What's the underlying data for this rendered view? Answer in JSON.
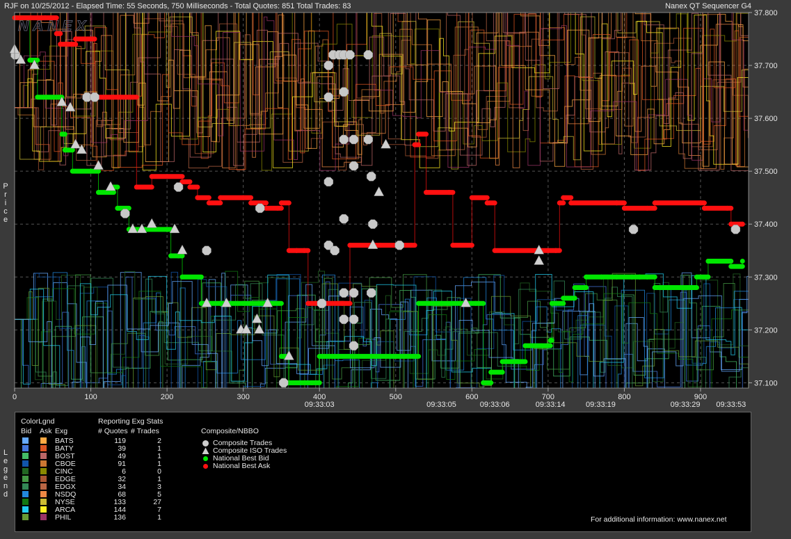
{
  "header": {
    "left": "RJF on 10/25/2012  -  Elapsed Time: 55 Seconds, 750 Milliseconds  -  Total Quotes: 851  Total Trades: 83",
    "right": "Nanex QT Sequencer G4",
    "watermark": "NANEX"
  },
  "side_labels": {
    "price": [
      "P",
      "r",
      "i",
      "c",
      "e"
    ],
    "legend": [
      "L",
      "e",
      "g",
      "e",
      "n",
      "d"
    ]
  },
  "chart_data": {
    "type": "line",
    "ylim": [
      37.09,
      37.8
    ],
    "xlim": [
      0,
      963
    ],
    "y_ticks": [
      "37.100",
      "37.200",
      "37.300",
      "37.400",
      "37.500",
      "37.600",
      "37.700",
      "37.800"
    ],
    "x_ticks": [
      "0",
      "100",
      "200",
      "300",
      "400",
      "500",
      "600",
      "700",
      "800",
      "900"
    ],
    "time_ticks": [
      {
        "x": 400,
        "label": "09:33:03"
      },
      {
        "x": 560,
        "label": "09:33:05"
      },
      {
        "x": 630,
        "label": "09:33:06"
      },
      {
        "x": 703,
        "label": "09:33:14"
      },
      {
        "x": 769,
        "label": "09:33:19"
      },
      {
        "x": 880,
        "label": "09:33:29"
      },
      {
        "x": 940,
        "label": "09:33:53"
      }
    ],
    "series": [
      {
        "name": "National Best Bid",
        "color": "#00e600",
        "points": [
          [
            0,
            37.79
          ],
          [
            20,
            37.71
          ],
          [
            30,
            37.64
          ],
          [
            60,
            37.64
          ],
          [
            62,
            37.57
          ],
          [
            66,
            37.54
          ],
          [
            76,
            37.5
          ],
          [
            100,
            37.5
          ],
          [
            110,
            37.46
          ],
          [
            130,
            37.47
          ],
          [
            135,
            37.43
          ],
          [
            150,
            37.39
          ],
          [
            200,
            37.39
          ],
          [
            205,
            37.34
          ],
          [
            215,
            37.34
          ],
          [
            220,
            37.3
          ],
          [
            245,
            37.25
          ],
          [
            255,
            37.25
          ],
          [
            270,
            37.25
          ],
          [
            300,
            37.25
          ],
          [
            320,
            37.25
          ],
          [
            350,
            37.15
          ],
          [
            360,
            37.1
          ],
          [
            390,
            37.1
          ],
          [
            400,
            37.15
          ],
          [
            420,
            37.15
          ],
          [
            480,
            37.15
          ],
          [
            500,
            37.15
          ],
          [
            530,
            37.25
          ],
          [
            560,
            37.25
          ],
          [
            590,
            37.25
          ],
          [
            605,
            37.25
          ],
          [
            615,
            37.1
          ],
          [
            625,
            37.12
          ],
          [
            640,
            37.14
          ],
          [
            660,
            37.14
          ],
          [
            670,
            37.17
          ],
          [
            700,
            37.17
          ],
          [
            703,
            37.18
          ],
          [
            705,
            37.25
          ],
          [
            720,
            37.26
          ],
          [
            735,
            37.28
          ],
          [
            750,
            37.3
          ],
          [
            770,
            37.3
          ],
          [
            790,
            37.3
          ],
          [
            810,
            37.3
          ],
          [
            820,
            37.3
          ],
          [
            830,
            37.3
          ],
          [
            840,
            37.28
          ],
          [
            880,
            37.28
          ],
          [
            895,
            37.3
          ],
          [
            910,
            37.33
          ],
          [
            925,
            37.33
          ],
          [
            940,
            37.32
          ],
          [
            955,
            37.33
          ]
        ]
      },
      {
        "name": "National Best Ask",
        "color": "#ff1010",
        "points": [
          [
            0,
            37.79
          ],
          [
            40,
            37.79
          ],
          [
            55,
            37.76
          ],
          [
            60,
            37.74
          ],
          [
            80,
            37.75
          ],
          [
            100,
            37.75
          ],
          [
            105,
            37.64
          ],
          [
            130,
            37.64
          ],
          [
            160,
            37.47
          ],
          [
            170,
            37.47
          ],
          [
            180,
            37.49
          ],
          [
            220,
            37.48
          ],
          [
            230,
            37.47
          ],
          [
            240,
            37.45
          ],
          [
            255,
            37.44
          ],
          [
            270,
            37.45
          ],
          [
            300,
            37.45
          ],
          [
            310,
            37.44
          ],
          [
            330,
            37.43
          ],
          [
            345,
            37.43
          ],
          [
            350,
            37.44
          ],
          [
            360,
            37.35
          ],
          [
            370,
            37.35
          ],
          [
            380,
            37.35
          ],
          [
            385,
            37.25
          ],
          [
            430,
            37.25
          ],
          [
            440,
            37.36
          ],
          [
            480,
            37.36
          ],
          [
            520,
            37.36
          ],
          [
            525,
            37.55
          ],
          [
            530,
            37.57
          ],
          [
            540,
            37.46
          ],
          [
            570,
            37.46
          ],
          [
            575,
            37.36
          ],
          [
            600,
            37.45
          ],
          [
            620,
            37.44
          ],
          [
            630,
            37.35
          ],
          [
            700,
            37.35
          ],
          [
            710,
            37.35
          ],
          [
            715,
            37.44
          ],
          [
            720,
            37.45
          ],
          [
            730,
            37.44
          ],
          [
            790,
            37.44
          ],
          [
            800,
            37.43
          ],
          [
            830,
            37.43
          ],
          [
            840,
            37.44
          ],
          [
            900,
            37.44
          ],
          [
            905,
            37.43
          ],
          [
            935,
            37.43
          ],
          [
            940,
            37.4
          ],
          [
            955,
            37.4
          ]
        ]
      }
    ],
    "composite_trades": [
      [
        1,
        37.72
      ],
      [
        95,
        37.64
      ],
      [
        105,
        37.64
      ],
      [
        145,
        37.42
      ],
      [
        215,
        37.47
      ],
      [
        252,
        37.35
      ],
      [
        322,
        37.43
      ],
      [
        353,
        37.1
      ],
      [
        403,
        37.25
      ],
      [
        412,
        37.7
      ],
      [
        418,
        37.72
      ],
      [
        426,
        37.72
      ],
      [
        432,
        37.72
      ],
      [
        440,
        37.72
      ],
      [
        464,
        37.72
      ],
      [
        412,
        37.64
      ],
      [
        432,
        37.65
      ],
      [
        432,
        37.56
      ],
      [
        445,
        37.56
      ],
      [
        464,
        37.56
      ],
      [
        445,
        37.51
      ],
      [
        412,
        37.48
      ],
      [
        432,
        37.41
      ],
      [
        470,
        37.4
      ],
      [
        412,
        37.36
      ],
      [
        420,
        37.35
      ],
      [
        432,
        37.27
      ],
      [
        445,
        37.27
      ],
      [
        468,
        37.27
      ],
      [
        432,
        37.22
      ],
      [
        445,
        37.22
      ],
      [
        445,
        37.17
      ],
      [
        468,
        37.49
      ],
      [
        505,
        37.36
      ],
      [
        812,
        37.39
      ],
      [
        946,
        37.39
      ]
    ],
    "composite_iso_trades": [
      [
        0,
        37.73
      ],
      [
        8,
        37.71
      ],
      [
        26,
        37.7
      ],
      [
        62,
        37.63
      ],
      [
        73,
        37.62
      ],
      [
        80,
        37.55
      ],
      [
        88,
        37.54
      ],
      [
        110,
        37.51
      ],
      [
        126,
        37.47
      ],
      [
        155,
        37.39
      ],
      [
        167,
        37.39
      ],
      [
        180,
        37.4
      ],
      [
        210,
        37.39
      ],
      [
        220,
        37.35
      ],
      [
        252,
        37.25
      ],
      [
        278,
        37.25
      ],
      [
        297,
        37.2
      ],
      [
        304,
        37.2
      ],
      [
        318,
        37.22
      ],
      [
        321,
        37.2
      ],
      [
        332,
        37.25
      ],
      [
        360,
        37.15
      ],
      [
        470,
        37.36
      ],
      [
        478,
        37.46
      ],
      [
        487,
        37.55
      ],
      [
        592,
        37.25
      ],
      [
        688,
        37.35
      ],
      [
        688,
        37.33
      ]
    ]
  },
  "legend": {
    "color_legend_title": "ColorLgnd",
    "stats_title": "Reporting Exg Stats",
    "composite_title": "Composite/NBBO",
    "col_bid": "Bid",
    "col_ask": "Ask",
    "col_exg": "Exg",
    "col_quotes": "# Quotes",
    "col_trades": "# Trades",
    "rows": [
      {
        "exg": "BATS",
        "quotes": "119",
        "trades": "2",
        "bid": "#66aaff",
        "ask": "#ffaa44"
      },
      {
        "exg": "BATY",
        "quotes": "39",
        "trades": "1",
        "bid": "#4477dd",
        "ask": "#dd5522"
      },
      {
        "exg": "BOST",
        "quotes": "49",
        "trades": "1",
        "bid": "#44bb66",
        "ask": "#bb6666"
      },
      {
        "exg": "CBOE",
        "quotes": "91",
        "trades": "1",
        "bid": "#1155aa",
        "ask": "#cc7733"
      },
      {
        "exg": "CINC",
        "quotes": "6",
        "trades": "0",
        "bid": "#226622",
        "ask": "#888800"
      },
      {
        "exg": "EDGE",
        "quotes": "32",
        "trades": "1",
        "bid": "#449944",
        "ask": "#aa5533"
      },
      {
        "exg": "EDGX",
        "quotes": "34",
        "trades": "3",
        "bid": "#338855",
        "ask": "#bb6644"
      },
      {
        "exg": "NSDQ",
        "quotes": "68",
        "trades": "5",
        "bid": "#2288dd",
        "ask": "#ee8844"
      },
      {
        "exg": "NYSE",
        "quotes": "133",
        "trades": "27",
        "bid": "#117711",
        "ask": "#ccbb33"
      },
      {
        "exg": "ARCA",
        "quotes": "144",
        "trades": "7",
        "bid": "#22ccee",
        "ask": "#ffee22"
      },
      {
        "exg": "PHIL",
        "quotes": "136",
        "trades": "1",
        "bid": "#669933",
        "ask": "#993366"
      }
    ],
    "composite_items": [
      {
        "label": "Composite Trades",
        "symbol": "circle",
        "color": "#cccccc"
      },
      {
        "label": "Composite ISO Trades",
        "symbol": "triangle",
        "color": "#cccccc"
      },
      {
        "label": "National Best Bid",
        "symbol": "dot",
        "color": "#00e600"
      },
      {
        "label": "National Best Ask",
        "symbol": "dot",
        "color": "#ff1010"
      }
    ],
    "footer": "For additional information: www.nanex.net"
  }
}
